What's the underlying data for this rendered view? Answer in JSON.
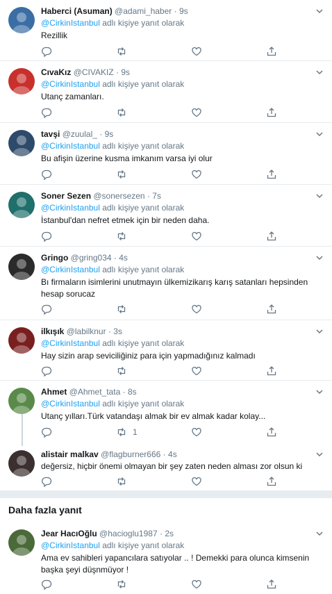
{
  "tweets": [
    {
      "name": "Haberci (Asuman)",
      "handle": "@adami_haber",
      "dot": "·",
      "time": "9s",
      "reply_prefix": "@CirkinIstanbul",
      "reply_suffix": " adlı kişiye yanıt olarak",
      "text": "Rezillik",
      "retweets": "",
      "avatar_color": "#3a6ea5"
    },
    {
      "name": "CıvaKız",
      "handle": "@CIVAKIZ",
      "dot": "·",
      "time": "9s",
      "reply_prefix": "@CirkinIstanbul",
      "reply_suffix": " adlı kişiye yanıt olarak",
      "text": "Utanç zamanları.",
      "retweets": "",
      "avatar_color": "#c8302c"
    },
    {
      "name": "tavşi",
      "handle": "@zuulal_",
      "dot": "·",
      "time": "9s",
      "reply_prefix": "@CirkinIstanbul",
      "reply_suffix": " adlı kişiye yanıt olarak",
      "text": "Bu afişin üzerine kusma imkanım varsa iyi olur",
      "retweets": "",
      "avatar_color": "#2e4a6b"
    },
    {
      "name": "Soner Sezen",
      "handle": "@sonersezen",
      "dot": "·",
      "time": "7s",
      "reply_prefix": "@CirkinIstanbul",
      "reply_suffix": " adlı kişiye yanıt olarak",
      "text": "İstanbul'dan nefret etmek için bir neden daha.",
      "retweets": "",
      "avatar_color": "#1f6f6a"
    },
    {
      "name": "Gringo",
      "handle": "@gring034",
      "dot": "·",
      "time": "4s",
      "reply_prefix": "@CirkinIstanbul",
      "reply_suffix": " adlı kişiye yanıt olarak",
      "text": "Bı firmaların isimlerini unutmayın ülkemizikarış karış satanları hepsinden hesap sorucaz",
      "retweets": "",
      "avatar_color": "#2b2b2b"
    },
    {
      "name": "ilkışık",
      "handle": "@labilknur",
      "dot": "·",
      "time": "3s",
      "reply_prefix": "@CirkinIstanbul",
      "reply_suffix": " adlı kişiye yanıt olarak",
      "text": "Hay sizin arap seviciliğiniz para için yapmadığınız kalmadı",
      "retweets": "",
      "avatar_color": "#7a1f1f"
    },
    {
      "name": "Ahmet",
      "handle": "@Ahmet_tata",
      "dot": "·",
      "time": "8s",
      "reply_prefix": "@CirkinIstanbul",
      "reply_suffix": " adlı kişiye yanıt olarak",
      "text": "Utanç yılları.Türk vatandaşı almak bir ev almak kadar kolay...",
      "retweets": "1",
      "avatar_color": "#5a8a4a"
    },
    {
      "name": "alistair malkav",
      "handle": "@flagburner666",
      "dot": "·",
      "time": "4s",
      "reply_prefix": "",
      "reply_suffix": "",
      "text": "değersiz, hiçbir önemi olmayan bir şey zaten neden alması zor olsun ki",
      "retweets": "",
      "avatar_color": "#3b2f2f"
    }
  ],
  "section": {
    "title": "Daha fazla yanıt"
  },
  "more_tweet": {
    "name": "Jear HacıOğlu",
    "handle": "@hacioglu1987",
    "dot": "·",
    "time": "2s",
    "reply_prefix": "@CirkinIstanbul",
    "reply_suffix": " adlı kişiye yanıt olarak",
    "text": "Ama ev sahibleri yapancılara satıyolar .. ! Demekki para olunca kimsenin başka şeyi düşnmüyor !",
    "retweets": "",
    "avatar_color": "#4a6a3a"
  },
  "colors": {
    "link": "#1da1f2",
    "secondary": "#657786",
    "border": "#e6ecf0"
  }
}
